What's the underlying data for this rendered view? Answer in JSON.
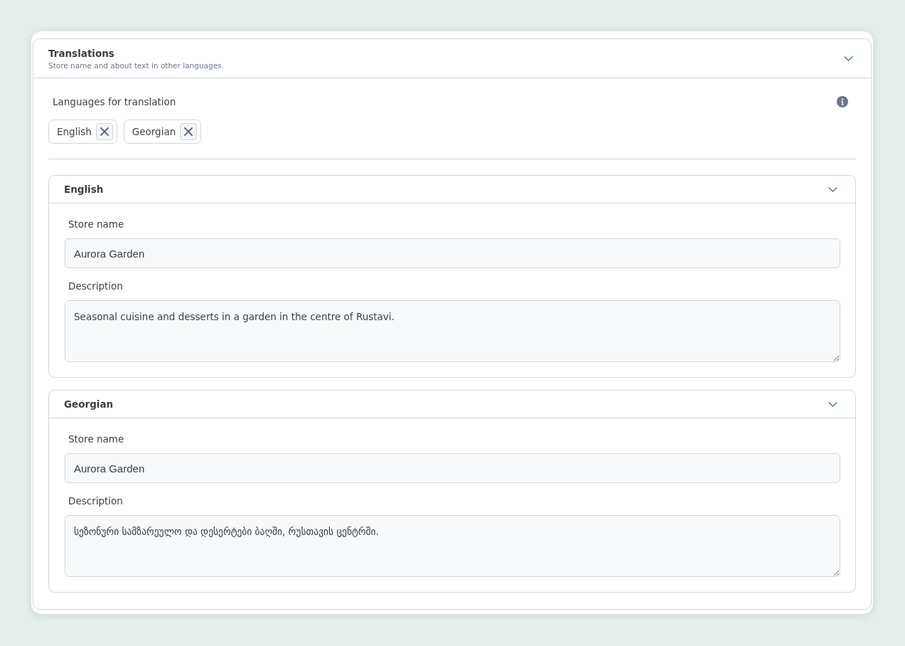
{
  "panel": {
    "title": "Translations",
    "subtitle": "Store name and about text in other languages.",
    "expanded": true
  },
  "languages_field": {
    "label": "Languages for translation",
    "chips": [
      {
        "label": "English"
      },
      {
        "label": "Georgian"
      }
    ]
  },
  "sections": [
    {
      "title": "English",
      "expanded": true,
      "fields": [
        {
          "kind": "input",
          "label": "Store name",
          "value": "Aurora Garden"
        },
        {
          "kind": "textarea",
          "label": "Description",
          "value": "Seasonal cuisine and desserts in a garden in the centre of Rustavi."
        }
      ]
    },
    {
      "title": "Georgian",
      "expanded": true,
      "fields": [
        {
          "kind": "input",
          "label": "Store name",
          "value": "Aurora Garden"
        },
        {
          "kind": "textarea",
          "label": "Description",
          "value": "სეზონური სამზარეულო და დესერტები ბაღში, რუსთავის ცენტრში."
        }
      ]
    }
  ]
}
